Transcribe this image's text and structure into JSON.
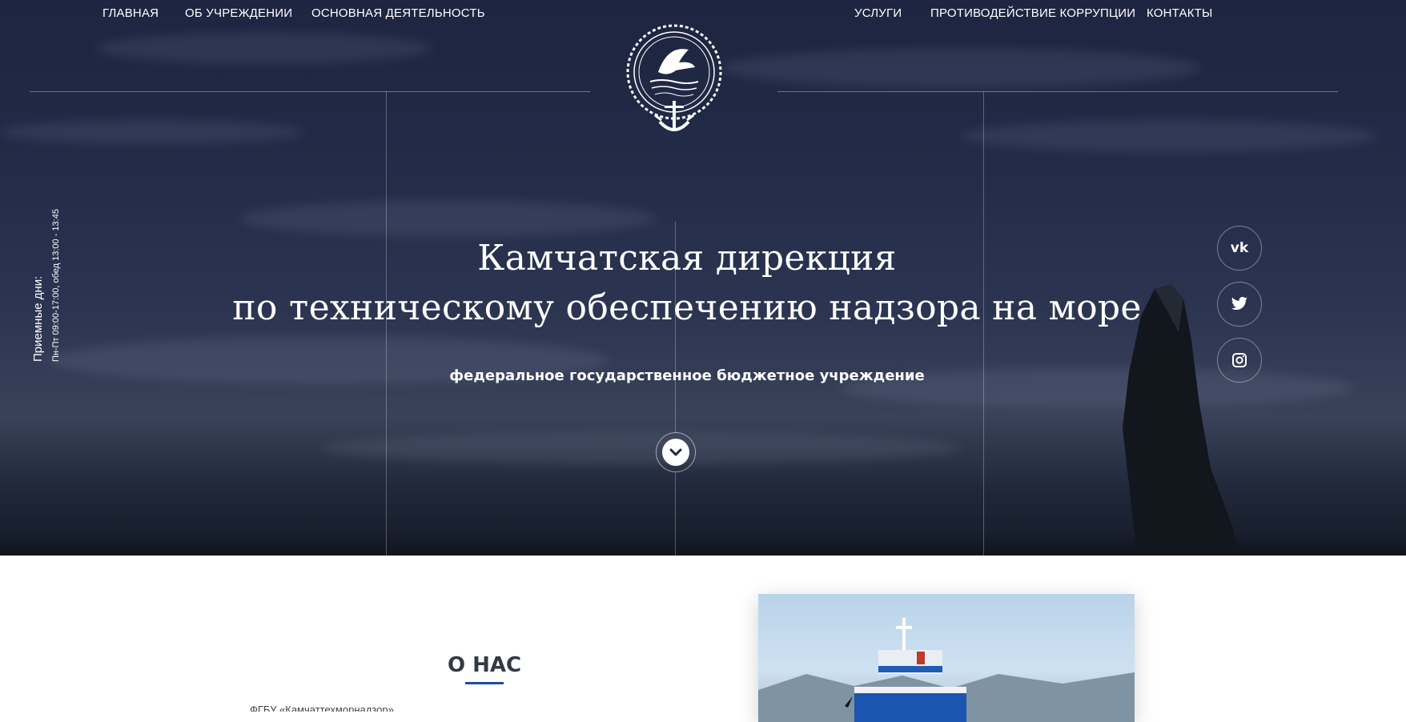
{
  "nav": {
    "left": [
      "ГЛАВНАЯ",
      "ОБ УЧРЕЖДЕНИИ",
      "ОСНОВНАЯ ДЕЯТЕЛЬНОСТЬ"
    ],
    "right": [
      "УСЛУГИ",
      "ПРОТИВОДЕЙСТВИЕ КОРРУПЦИИ",
      "КОНТАКТЫ"
    ]
  },
  "logo": {
    "ring_text": "ФГБУ «Камчаттехморнадзор»",
    "icon": "orca-anchor-emblem-icon"
  },
  "hero": {
    "title_line1": "Камчатская дирекция",
    "title_line2": "по техническому обеспечению надзора на море",
    "subtitle": "федеральное государственное бюджетное учреждение",
    "scroll_icon": "chevron-down-icon"
  },
  "schedule": {
    "label": "Приемные дни:",
    "hours": "Пн-Пт 09:00-17:00, обед 13:00 - 13:45"
  },
  "social": [
    {
      "name": "vk",
      "glyph": "vk",
      "icon": "vk-icon"
    },
    {
      "name": "twitter",
      "icon": "twitter-icon"
    },
    {
      "name": "instagram",
      "icon": "instagram-icon"
    }
  ],
  "about": {
    "title": "О НАС",
    "text_start": "ФГБУ «Камчаттехморнадзор»",
    "accent_color": "#1d4f9c"
  },
  "colors": {
    "hero_bg": "#222b47",
    "text": "#ffffff",
    "heading_dark": "#333a45"
  }
}
